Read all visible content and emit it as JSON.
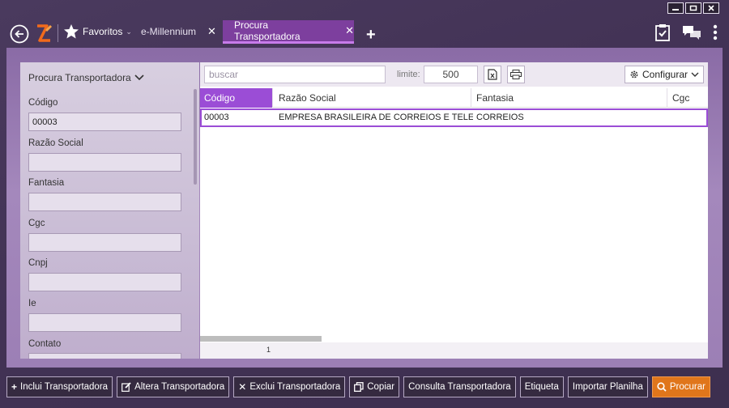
{
  "window": {
    "controls": [
      "minimize-icon",
      "maximize-icon",
      "close-icon"
    ]
  },
  "header": {
    "favorites_label": "Favoritos",
    "tabs": [
      {
        "label": "e-Millennium",
        "active": false
      },
      {
        "label": "Procura Transportadora",
        "active": true
      }
    ],
    "accent_color": "#7d3f9e"
  },
  "filter_panel": {
    "title": "Procura Transportadora",
    "fields": [
      {
        "label": "Código",
        "value": "00003"
      },
      {
        "label": "Razão Social",
        "value": ""
      },
      {
        "label": "Fantasia",
        "value": ""
      },
      {
        "label": "Cgc",
        "value": ""
      },
      {
        "label": "Cnpj",
        "value": ""
      },
      {
        "label": "Ie",
        "value": ""
      },
      {
        "label": "Contato",
        "value": ""
      }
    ]
  },
  "grid": {
    "search_placeholder": "buscar",
    "limite_label": "limite:",
    "limite_value": "500",
    "config_label": "Configurar",
    "columns": [
      "Código",
      "Razão Social",
      "Fantasia",
      "Cgc"
    ],
    "rows": [
      [
        "00003",
        "EMPRESA BRASILEIRA DE CORREIOS E TELEG...",
        "CORREIOS",
        ""
      ]
    ],
    "page": "1"
  },
  "actions": [
    {
      "label": "Inclui Transportadora",
      "icon": "plus-icon"
    },
    {
      "label": "Altera Transportadora",
      "icon": "edit-icon"
    },
    {
      "label": "Exclui Transportadora",
      "icon": "x-icon"
    },
    {
      "label": "Copiar",
      "icon": "copy-icon"
    },
    {
      "label": "Consulta Transportadora",
      "icon": ""
    },
    {
      "label": "Etiqueta",
      "icon": ""
    },
    {
      "label": "Importar Planilha",
      "icon": ""
    },
    {
      "label": "Procurar",
      "icon": "search-icon",
      "primary": true
    }
  ],
  "colors": {
    "primary_button": "#e0761b",
    "selection": "#9b4dd6"
  }
}
